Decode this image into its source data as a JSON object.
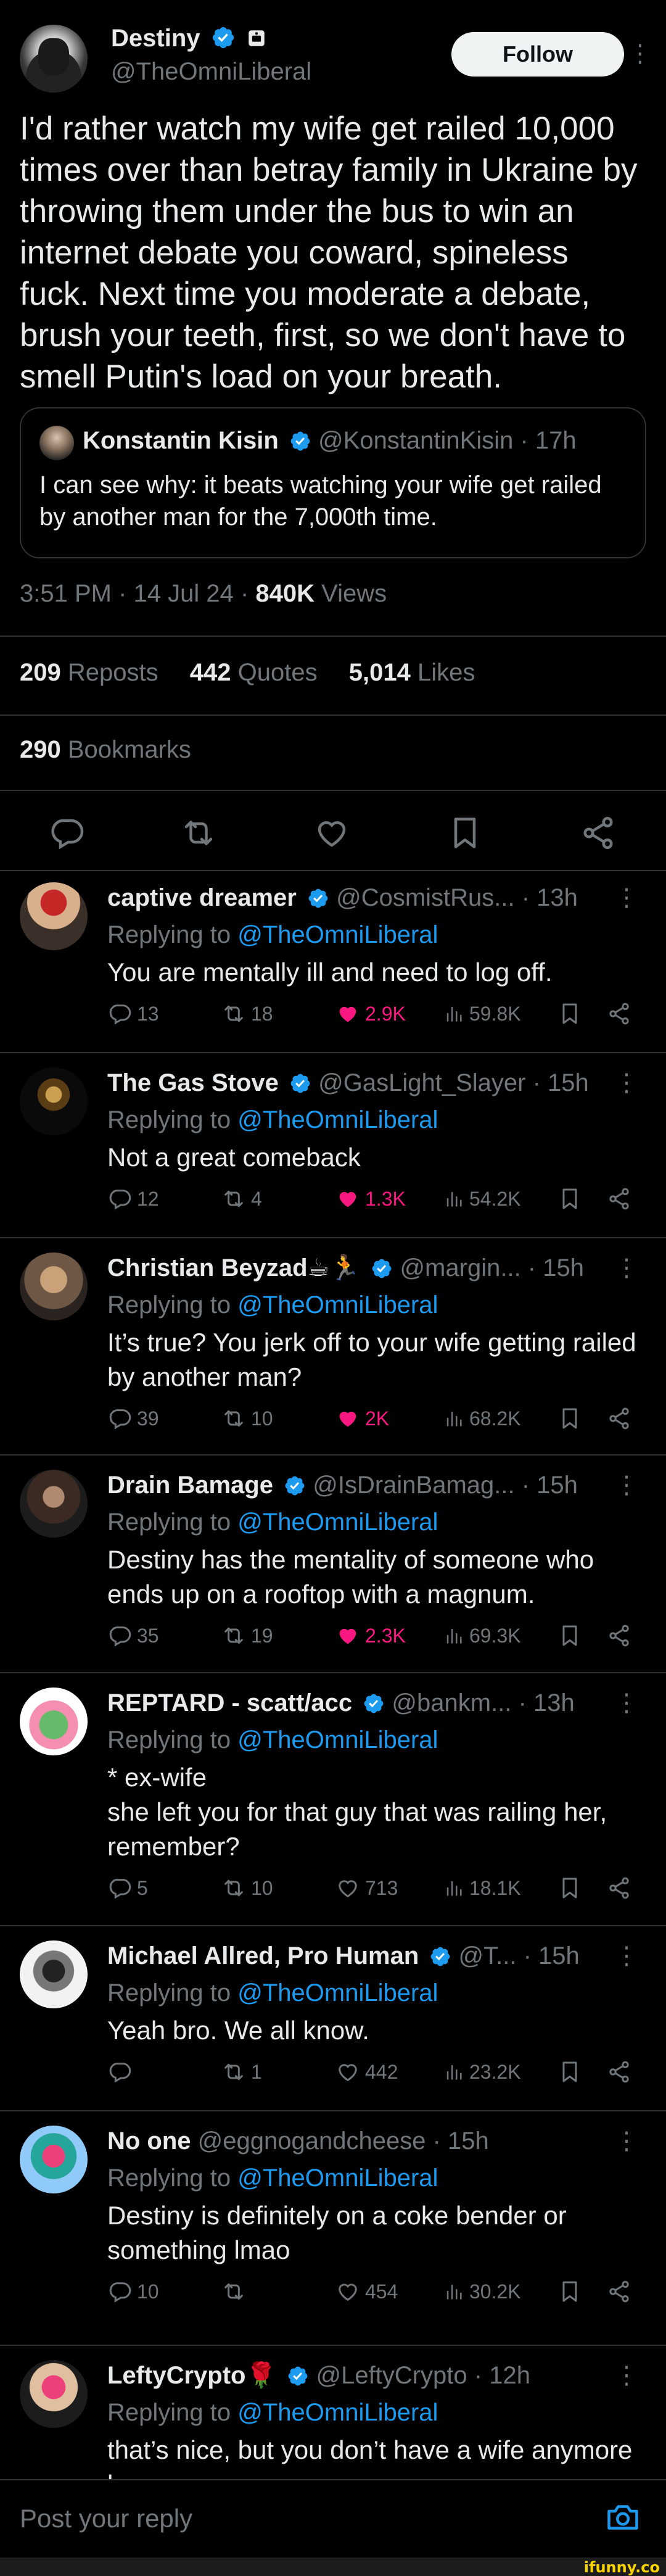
{
  "main_tweet": {
    "author_name": "Destiny",
    "author_handle": "@TheOmniLiberal",
    "follow_label": "Follow",
    "text": "I'd rather watch my wife get railed 10,000 times over than betray family in Ukraine by throwing them under the bus to win an internet debate you coward, spineless fuck. Next time you moderate a debate, brush your teeth, first, so we don't have to smell Putin's load on your breath.",
    "quote": {
      "author_name": "Konstantin Kisin",
      "author_handle": "@KonstantinKisin",
      "time": "· 17h",
      "text": "I can see why: it beats watching your wife get railed by another man for the 7,000th time."
    },
    "time": "3:51 PM · 14 Jul 24 ·",
    "views_count": "840K",
    "views_label": "Views",
    "reposts_count": "209",
    "reposts_label": "Reposts",
    "quotes_count": "442",
    "quotes_label": "Quotes",
    "likes_count": "5,014",
    "likes_label": "Likes",
    "bookmarks_count": "290",
    "bookmarks_label": "Bookmarks"
  },
  "replies": [
    {
      "name": "captive dreamer",
      "handle": "@CosmistRus...",
      "time": "· 13h",
      "replying_prefix": "Replying to",
      "replying_to": "@TheOmniLiberal",
      "text": "You are mentally ill and need to log off.",
      "comments": "13",
      "reposts": "18",
      "likes": "2.9K",
      "views": "59.8K",
      "liked": true
    },
    {
      "name": "The Gas Stove",
      "handle": "@GasLight_Slayer",
      "time": "· 15h",
      "replying_prefix": "Replying to",
      "replying_to": "@TheOmniLiberal",
      "text": "Not a great comeback",
      "comments": "12",
      "reposts": "4",
      "likes": "1.3K",
      "views": "54.2K",
      "liked": true
    },
    {
      "name": "Christian Beyzad☕🏃",
      "handle": "@margin...",
      "time": "· 15h",
      "replying_prefix": "Replying to",
      "replying_to": "@TheOmniLiberal",
      "text": "It’s true? You jerk off to your wife getting railed by another man?",
      "comments": "39",
      "reposts": "10",
      "likes": "2K",
      "views": "68.2K",
      "liked": true
    },
    {
      "name": "Drain Bamage",
      "handle": "@IsDrainBamag...",
      "time": "· 15h",
      "replying_prefix": "Replying to",
      "replying_to": "@TheOmniLiberal",
      "text": "Destiny has the mentality of someone who ends up on a rooftop with a magnum.",
      "comments": "35",
      "reposts": "19",
      "likes": "2.3K",
      "views": "69.3K",
      "liked": true
    },
    {
      "name": "REPTARD - scatt/acc",
      "handle": "@bankm...",
      "time": "· 13h",
      "replying_prefix": "Replying to",
      "replying_to": "@TheOmniLiberal",
      "text": "* ex-wife\nshe left you for that guy that was railing her, remember?",
      "comments": "5",
      "reposts": "10",
      "likes": "713",
      "views": "18.1K",
      "liked": false
    },
    {
      "name": "Michael Allred, Pro Human",
      "handle": "@T...",
      "time": "· 15h",
      "replying_prefix": "Replying to",
      "replying_to": "@TheOmniLiberal",
      "text": "Yeah bro. We all know.",
      "comments": "",
      "reposts": "1",
      "likes": "442",
      "views": "23.2K",
      "liked": false
    },
    {
      "name": "No one",
      "handle": "@eggnogandcheese",
      "time": "· 15h",
      "replying_prefix": "Replying to",
      "replying_to": "@TheOmniLiberal",
      "text": "Destiny is definitely on a coke bender or something lmao",
      "comments": "10",
      "reposts": "",
      "likes": "454",
      "views": "30.2K",
      "liked": false
    },
    {
      "name": "LeftyCrypto🌹",
      "handle": "@LeftyCrypto",
      "time": "· 12h",
      "replying_prefix": "Replying to",
      "replying_to": "@TheOmniLiberal",
      "text": "that’s nice, but you don’t have a wife anymore lmao",
      "comments": "",
      "reposts": "",
      "likes": "",
      "views": "",
      "liked": false
    }
  ],
  "reply_bar": {
    "placeholder": "Post your reply"
  },
  "watermark": "ifunny.co",
  "colors": {
    "accent": "#1d9bf0",
    "like": "#f91880",
    "muted": "#71767b",
    "text": "#e7e9ea",
    "divider": "#2f3336"
  }
}
